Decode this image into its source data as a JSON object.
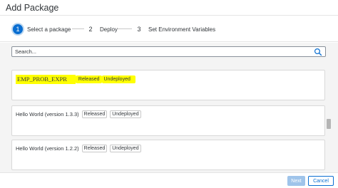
{
  "dialog": {
    "title": "Add Package"
  },
  "wizard": {
    "steps": [
      {
        "number": "1",
        "label": "Select a package",
        "active": true
      },
      {
        "number": "2",
        "label": "Deploy",
        "active": false
      },
      {
        "number": "3",
        "label": "Set Environment Variables",
        "active": false
      }
    ]
  },
  "search": {
    "placeholder": "Search...",
    "value": ""
  },
  "packages": [
    {
      "name": "EMP_PROB_EXPR",
      "status": "Released",
      "deployment": "Undeployed",
      "highlighted": true
    },
    {
      "name": "Hello World  (version 1.3.3)",
      "status": "Released",
      "deployment": "Undeployed",
      "highlighted": false
    },
    {
      "name": "Hello World  (version 1.2.2)",
      "status": "Released",
      "deployment": "Undeployed",
      "highlighted": false
    }
  ],
  "footer": {
    "next_label": "Next",
    "cancel_label": "Cancel"
  },
  "colors": {
    "accent": "#0a6ed1",
    "highlight": "#ffff00",
    "next_disabled": "#9fc4ea"
  },
  "icons": {
    "search": "search-icon"
  }
}
